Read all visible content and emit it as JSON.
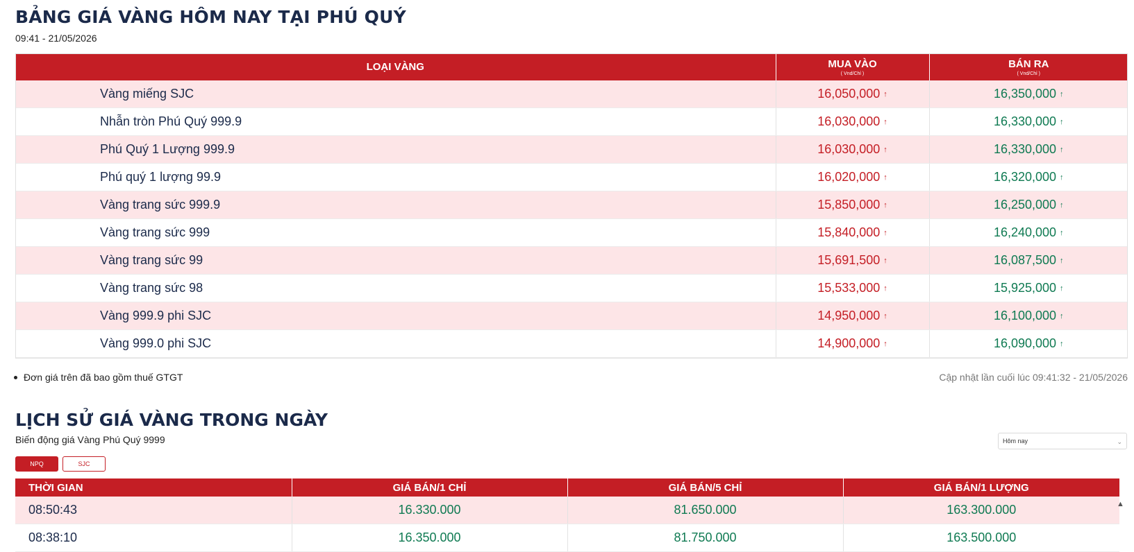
{
  "header": {
    "title": "BẢNG GIÁ VÀNG HÔM NAY TẠI PHÚ QUÝ",
    "timestamp": "09:41 - 21/05/2026"
  },
  "price_table": {
    "columns": {
      "type": "LOẠI VÀNG",
      "buy": "MUA VÀO",
      "buy_unit": "( Vnd/Chỉ )",
      "sell": "BÁN RA",
      "sell_unit": "( Vnd/Chỉ )"
    },
    "up_arrow": "↑",
    "rows": [
      {
        "name": "Vàng miếng SJC",
        "buy": "16,050,000",
        "sell": "16,350,000"
      },
      {
        "name": "Nhẫn tròn Phú Quý 999.9",
        "buy": "16,030,000",
        "sell": "16,330,000"
      },
      {
        "name": "Phú Quý 1 Lượng 999.9",
        "buy": "16,030,000",
        "sell": "16,330,000"
      },
      {
        "name": "Phú quý 1 lượng 99.9",
        "buy": "16,020,000",
        "sell": "16,320,000"
      },
      {
        "name": "Vàng trang sức 999.9",
        "buy": "15,850,000",
        "sell": "16,250,000"
      },
      {
        "name": "Vàng trang sức 999",
        "buy": "15,840,000",
        "sell": "16,240,000"
      },
      {
        "name": "Vàng trang sức 99",
        "buy": "15,691,500",
        "sell": "16,087,500"
      },
      {
        "name": "Vàng trang sức 98",
        "buy": "15,533,000",
        "sell": "15,925,000"
      },
      {
        "name": "Vàng 999.9 phi SJC",
        "buy": "14,950,000",
        "sell": "16,100,000"
      },
      {
        "name": "Vàng 999.0 phi SJC",
        "buy": "14,900,000",
        "sell": "16,090,000"
      }
    ]
  },
  "note": "Đơn giá trên đã bao gồm thuế GTGT",
  "last_updated": "Cập nhật lần cuối lúc 09:41:32 - 21/05/2026",
  "history": {
    "title": "LỊCH SỬ GIÁ VÀNG TRONG NGÀY",
    "subtitle": "Biến động giá Vàng Phú Quý 9999",
    "select_value": "Hôm nay",
    "tabs": [
      "NPQ",
      "SJC"
    ],
    "columns": [
      "THỜI GIAN",
      "GIÁ BÁN/1 CHỈ",
      "GIÁ BÁN/5 CHỈ",
      "GIÁ BÁN/1 LƯỢNG"
    ],
    "rows": [
      {
        "time": "08:50:43",
        "c1": "16.330.000",
        "c5": "81.650.000",
        "l1": "163.300.000"
      },
      {
        "time": "08:38:10",
        "c1": "16.350.000",
        "c5": "81.750.000",
        "l1": "163.500.000"
      }
    ]
  },
  "colors": {
    "brand_red": "#c41e25",
    "row_pink": "#fde5e7",
    "buy_red": "#c41e25",
    "sell_green": "#0f7a52",
    "title_navy": "#1b2a4a"
  }
}
